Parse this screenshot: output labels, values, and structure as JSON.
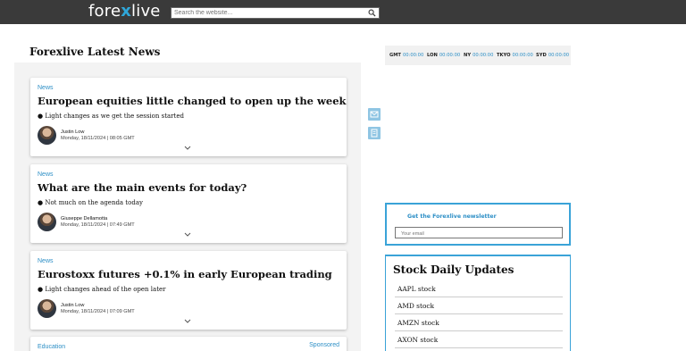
{
  "header": {
    "logo_text_1": "fore",
    "logo_text_2": "x",
    "logo_text_3": "live",
    "search_placeholder": "Search the website..."
  },
  "main": {
    "section_title": "Forexlive Latest News",
    "articles": [
      {
        "category": "News",
        "headline": "European equities little changed to open up the week",
        "summary": "● Light changes as we get the session started",
        "author": "Justin Low",
        "date": "Monday, 18/11/2024 | 08:05 GMT"
      },
      {
        "category": "News",
        "headline": "What are the main events for today?",
        "summary": "● Not much on the agenda today",
        "author": "Giuseppe Dellamotta",
        "date": "Monday, 18/11/2024 | 07:49 GMT"
      },
      {
        "category": "News",
        "headline": "Eurostoxx futures +0.1% in early European trading",
        "summary": "● Light changes ahead of the open later",
        "author": "Justin Low",
        "date": "Monday, 18/11/2024 | 07:09 GMT"
      }
    ],
    "promo": {
      "category": "Education",
      "sponsored_label": "Sponsored"
    }
  },
  "clocks": [
    {
      "zone": "GMT",
      "time": "00:00:00"
    },
    {
      "zone": "LON",
      "time": "00:00:00"
    },
    {
      "zone": "NY",
      "time": "00:00:00"
    },
    {
      "zone": "TKYO",
      "time": "00:00:00"
    },
    {
      "zone": "SYD",
      "time": "00:00:00"
    }
  ],
  "share_icons": [
    "mail-icon",
    "document-icon"
  ],
  "newsletter": {
    "title": "Get the Forexlive newsletter",
    "email_placeholder": "Your email"
  },
  "stocks": {
    "title": "Stock Daily Updates",
    "items": [
      "AAPL stock",
      "AMD stock",
      "AMZN stock",
      "AXON stock"
    ]
  },
  "colors": {
    "accent": "#2d8fc6",
    "topbar": "#3a3a3a",
    "border_accent": "#3aa3d8"
  }
}
